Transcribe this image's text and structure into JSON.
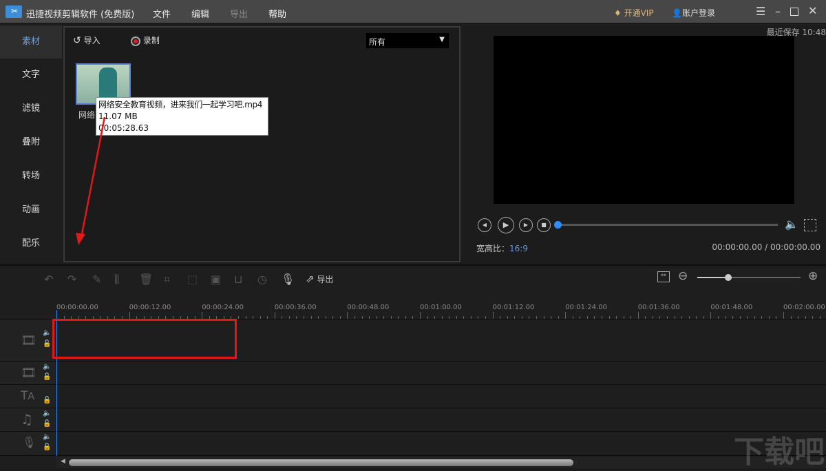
{
  "app": {
    "title": "迅捷视频剪辑软件 (免费版)",
    "menu": [
      "文件",
      "编辑",
      "导出",
      "帮助"
    ],
    "vip": "开通VIP",
    "account": "账户登录"
  },
  "sidebar": {
    "items": [
      "素材",
      "文字",
      "滤镜",
      "叠附",
      "转场",
      "动画",
      "配乐"
    ],
    "active": 0
  },
  "media": {
    "import": "导入",
    "record": "录制",
    "filter": "所有",
    "item_label": "网络",
    "tooltip": {
      "name": "网络安全教育视频，进来我们一起学习吧.mp4",
      "size": "11.07 MB",
      "duration": "00:05:28.63"
    }
  },
  "preview": {
    "last_saved": "最近保存 10:48",
    "aspect_label": "宽高比：",
    "aspect": "16:9",
    "time": "00:00:00.00 / 00:00:00.00",
    "progress": 0
  },
  "timeline": {
    "export": "导出",
    "zoom_level": 0.3,
    "ruler": [
      "00:00:00.00",
      "00:00:12.00",
      "00:00:24.00",
      "00:00:36.00",
      "00:00:48.00",
      "00:01:00.00",
      "00:01:12.00",
      "00:01:24.00",
      "00:01:36.00",
      "00:01:48.00",
      "00:02:00.00"
    ]
  },
  "watermark": "下载吧",
  "colors": {
    "accent": "#2f8cff",
    "annotation": "#e01818"
  }
}
